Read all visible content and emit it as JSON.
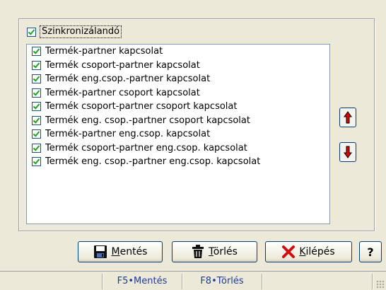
{
  "group": {
    "label": "Szinkronizálandó",
    "checked": true
  },
  "list": {
    "items": [
      {
        "label": "Termék-partner kapcsolat",
        "checked": true
      },
      {
        "label": "Termék csoport-partner kapcsolat",
        "checked": true
      },
      {
        "label": "Termék eng.csop.-partner kapcsolat",
        "checked": true
      },
      {
        "label": "Termék-partner csoport kapcsolat",
        "checked": true
      },
      {
        "label": "Termék csoport-partner csoport kapcsolat",
        "checked": true
      },
      {
        "label": "Termék eng. csop.-partner csoport kapcsolat",
        "checked": true
      },
      {
        "label": "Termék-partner eng.csop. kapcsolat",
        "checked": true
      },
      {
        "label": "Termék csoport-partner eng.csop. kapcsolat",
        "checked": true
      },
      {
        "label": "Termék eng. csop.-partner eng.csop. kapcsolat",
        "checked": true
      }
    ]
  },
  "reorder": {
    "up_icon": "arrow-up-icon",
    "down_icon": "arrow-down-icon",
    "arrow_color": "#e00000"
  },
  "buttons": {
    "save": {
      "label": "Mentés",
      "icon": "floppy-disk-icon"
    },
    "delete": {
      "label": "Törlés",
      "icon": "trash-can-icon"
    },
    "exit": {
      "label": "Kilépés",
      "icon": "red-x-icon"
    },
    "help": {
      "label": "?"
    }
  },
  "statusbar": {
    "save_hint": "F5•Mentés",
    "delete_hint": "F8•Törlés"
  }
}
